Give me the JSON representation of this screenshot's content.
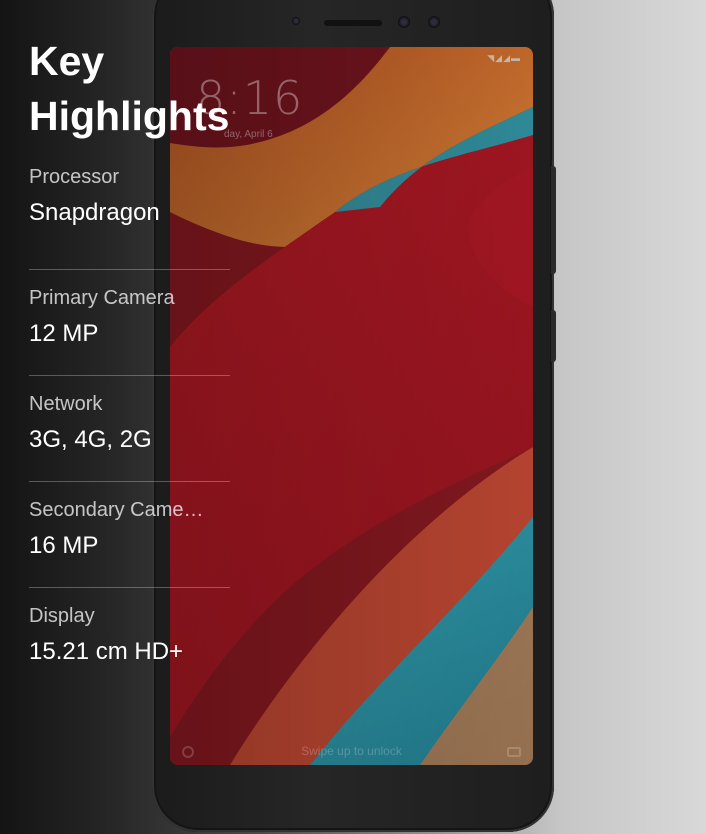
{
  "highlights": {
    "title": "Key Highlights",
    "specs": [
      {
        "label": "Processor",
        "value": "Snapdragon"
      },
      {
        "label": "Primary Camera",
        "value": "12 MP"
      },
      {
        "label": "Network",
        "value": "3G, 4G, 2G"
      },
      {
        "label": "Secondary Came…",
        "value": "16 MP"
      },
      {
        "label": "Display",
        "value": "15.21 cm HD+"
      }
    ]
  },
  "phone_screen": {
    "time": "8:16",
    "date": "day, April 6",
    "unlock_hint": "Swipe up to unlock"
  },
  "colors": {
    "background_dark": "#141414",
    "background_light": "#d8d8d8",
    "wallpaper_red": "#c8202a",
    "wallpaper_orange": "#d9732c",
    "wallpaper_teal": "#2fa3b5"
  },
  "icons": [
    "signal-icon",
    "wifi-icon",
    "battery-icon",
    "camera-shortcut-icon",
    "assistant-icon"
  ]
}
